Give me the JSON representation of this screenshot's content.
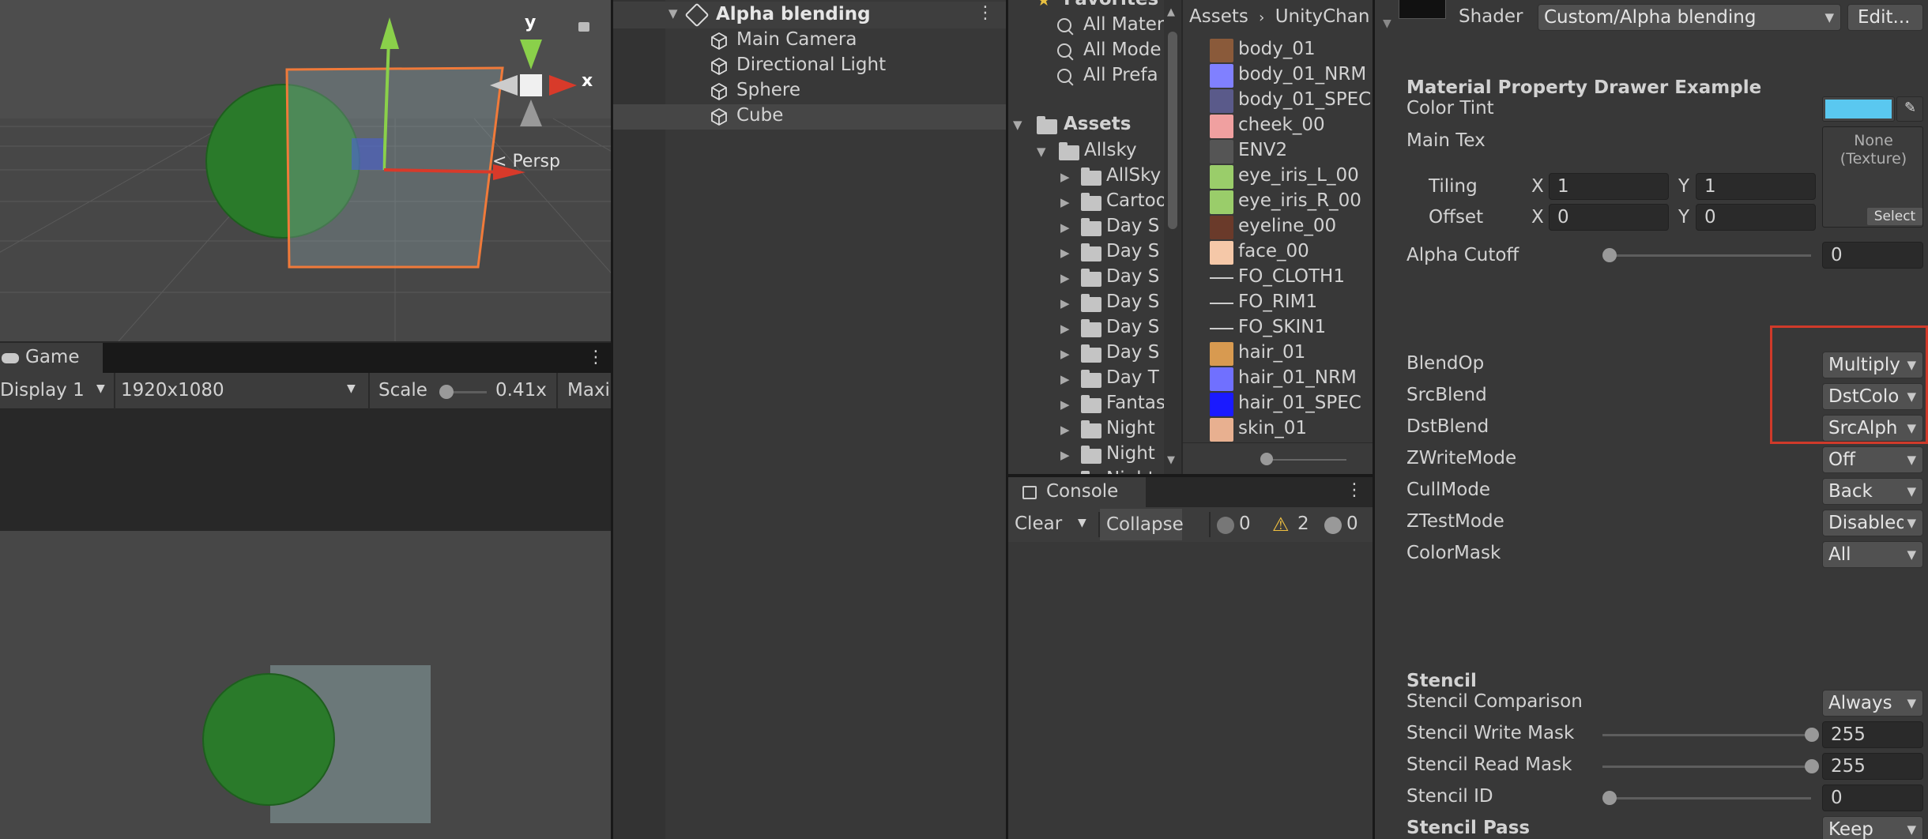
{
  "scene": {
    "axis_y": "y",
    "axis_x": "x",
    "persp_label": "Persp"
  },
  "game": {
    "tab_label": "Game",
    "display": "Display 1",
    "resolution": "1920x1080",
    "scale_label": "Scale",
    "scale_value": "0.41x",
    "maximize_label": "Maxi"
  },
  "hierarchy": {
    "scene_name": "Alpha blending",
    "items": [
      "Main Camera",
      "Directional Light",
      "Sphere",
      "Cube"
    ]
  },
  "project": {
    "favorites_label": "Favorites",
    "favorites": [
      "All Mater",
      "All Mode",
      "All Prefa"
    ],
    "assets_label": "Assets",
    "allsky_label": "Allsky",
    "folders": [
      "AllSky",
      "Cartoo",
      "Day S",
      "Day S",
      "Day S",
      "Day S",
      "Day S",
      "Day S",
      "Day T",
      "Fantas",
      "Night",
      "Night",
      "Night"
    ],
    "breadcrumb": [
      "Assets",
      "UnityChan"
    ],
    "files": [
      {
        "name": "body_01",
        "color": "#8a5a3a"
      },
      {
        "name": "body_01_NRM",
        "color": "#8080ff"
      },
      {
        "name": "body_01_SPEC",
        "color": "#5a5a8a"
      },
      {
        "name": "cheek_00",
        "color": "#f0a0a0"
      },
      {
        "name": "ENV2",
        "color": "#555555"
      },
      {
        "name": "eye_iris_L_00",
        "color": "#9acd6a"
      },
      {
        "name": "eye_iris_R_00",
        "color": "#9acd6a"
      },
      {
        "name": "eyeline_00",
        "color": "#6a3a2a"
      },
      {
        "name": "face_00",
        "color": "#f5c8a8"
      },
      {
        "name": "FO_CLOTH1",
        "color": "#cccccc"
      },
      {
        "name": "FO_RIM1",
        "color": "#cccccc"
      },
      {
        "name": "FO_SKIN1",
        "color": "#cccccc"
      },
      {
        "name": "hair_01",
        "color": "#d89a50"
      },
      {
        "name": "hair_01_NRM",
        "color": "#7070ff"
      },
      {
        "name": "hair_01_SPEC",
        "color": "#1a1aff"
      },
      {
        "name": "skin_01",
        "color": "#e8b090"
      }
    ]
  },
  "console": {
    "tab_label": "Console",
    "clear_label": "Clear",
    "collapse_label": "Collapse",
    "log_count": "0",
    "warn_count": "2",
    "error_count": "0"
  },
  "inspector": {
    "shader_label": "Shader",
    "shader_value": "Custom/Alpha blending",
    "edit_label": "Edit...",
    "section_title": "Material Property Drawer Example",
    "color_tint_label": "Color Tint",
    "color_tint_value": "#5ac8f0",
    "main_tex_label": "Main Tex",
    "texture_none": "None\n(Texture)",
    "texture_select": "Select",
    "tiling_label": "Tiling",
    "offset_label": "Offset",
    "x_label": "X",
    "y_label": "Y",
    "tiling_x": "1",
    "tiling_y": "1",
    "offset_x": "0",
    "offset_y": "0",
    "alpha_cutoff_label": "Alpha Cutoff",
    "alpha_cutoff_value": "0",
    "blend": [
      {
        "label": "BlendOp",
        "value": "Multiply"
      },
      {
        "label": "SrcBlend",
        "value": "DstColo"
      },
      {
        "label": "DstBlend",
        "value": "SrcAlph"
      },
      {
        "label": "ZWriteMode",
        "value": "Off"
      },
      {
        "label": "CullMode",
        "value": "Back"
      },
      {
        "label": "ZTestMode",
        "value": "Disabled"
      },
      {
        "label": "ColorMask",
        "value": "All"
      }
    ],
    "stencil_title": "Stencil",
    "stencil_comparison_label": "Stencil Comparison",
    "stencil_comparison_value": "Always",
    "stencil_write_label": "Stencil Write Mask",
    "stencil_write_value": "255",
    "stencil_read_label": "Stencil Read Mask",
    "stencil_read_value": "255",
    "stencil_id_label": "Stencil ID",
    "stencil_id_value": "0",
    "stencil_pass_label": "Stencil Pass",
    "stencil_pass_value": "Keep",
    "highlight_color": "#d03a2a"
  }
}
